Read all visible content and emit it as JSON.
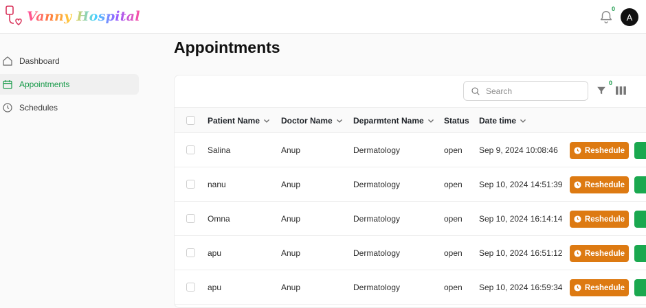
{
  "app": {
    "logo_text": "Vanny Hospital",
    "notification_count": "0",
    "avatar_initial": "A"
  },
  "sidebar": {
    "items": [
      {
        "label": "Dashboard",
        "icon": "home-icon",
        "active": false
      },
      {
        "label": "Appointments",
        "icon": "calendar-icon",
        "active": true
      },
      {
        "label": "Schedules",
        "icon": "clock-icon",
        "active": false
      }
    ]
  },
  "page": {
    "title": "Appointments"
  },
  "toolbar": {
    "search_placeholder": "Search",
    "filter_count": "0"
  },
  "table": {
    "columns": [
      "Patient Name",
      "Doctor Name",
      "Deparmtent Name",
      "Status",
      "Date time"
    ],
    "action_label": "Reshedule",
    "rows": [
      {
        "patient": "Salina",
        "doctor": "Anup",
        "department": "Dermatology",
        "status": "open",
        "datetime": "Sep 9, 2024 10:08:46"
      },
      {
        "patient": "nanu",
        "doctor": "Anup",
        "department": "Dermatology",
        "status": "open",
        "datetime": "Sep 10, 2024 14:51:39"
      },
      {
        "patient": "Omna",
        "doctor": "Anup",
        "department": "Dermatology",
        "status": "open",
        "datetime": "Sep 10, 2024 16:14:14"
      },
      {
        "patient": "apu",
        "doctor": "Anup",
        "department": "Dermatology",
        "status": "open",
        "datetime": "Sep 10, 2024 16:51:12"
      },
      {
        "patient": "apu",
        "doctor": "Anup",
        "department": "Dermatology",
        "status": "open",
        "datetime": "Sep 10, 2024 16:59:34"
      }
    ]
  },
  "colors": {
    "accent_green": "#1a9b4b",
    "reschedule_orange": "#dd7a12"
  }
}
